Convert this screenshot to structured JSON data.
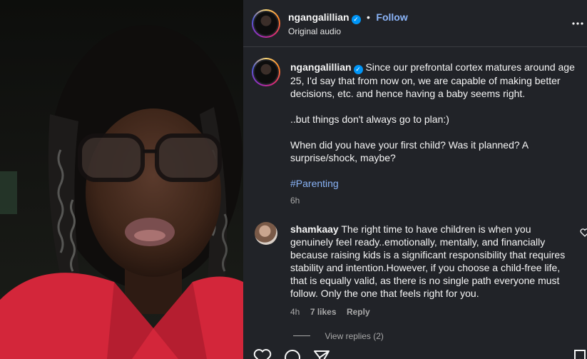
{
  "header": {
    "username": "ngangalillian",
    "dot": "•",
    "follow_label": "Follow",
    "audio_label": "Original audio",
    "more_label": "..."
  },
  "caption": {
    "username": "ngangalillian",
    "paragraph_1": "Since our prefrontal cortex matures around age 25, I'd say that from now on, we are capable of making better decisions, etc. and hence having a baby seems right.",
    "paragraph_2": "..but things don't always go to plan:)",
    "paragraph_3": "When did you have your first child? Was it planned? A surprise/shock, maybe?",
    "hashtag": "#Parenting",
    "time": "6h"
  },
  "comment": {
    "username": "shamkaay",
    "text": "The right time to have children is when you genuinely feel ready..emotionally, mentally, and financially because raising kids is a significant responsibility that requires stability and intention.However, if you choose a child-free life, that is equally valid, as there is no single path everyone must follow. Only the one that feels right for you.",
    "time": "4h",
    "likes": "7 likes",
    "reply_label": "Reply",
    "view_replies": "View replies (2)"
  },
  "icons": [
    "heart-icon",
    "comment-icon",
    "share-icon",
    "bookmark-icon",
    "more-icon",
    "verified-icon"
  ],
  "colors": {
    "panel_bg": "#212328",
    "link": "#8ab4f8",
    "verified": "#0095f6",
    "shirt": "#d3263a"
  }
}
